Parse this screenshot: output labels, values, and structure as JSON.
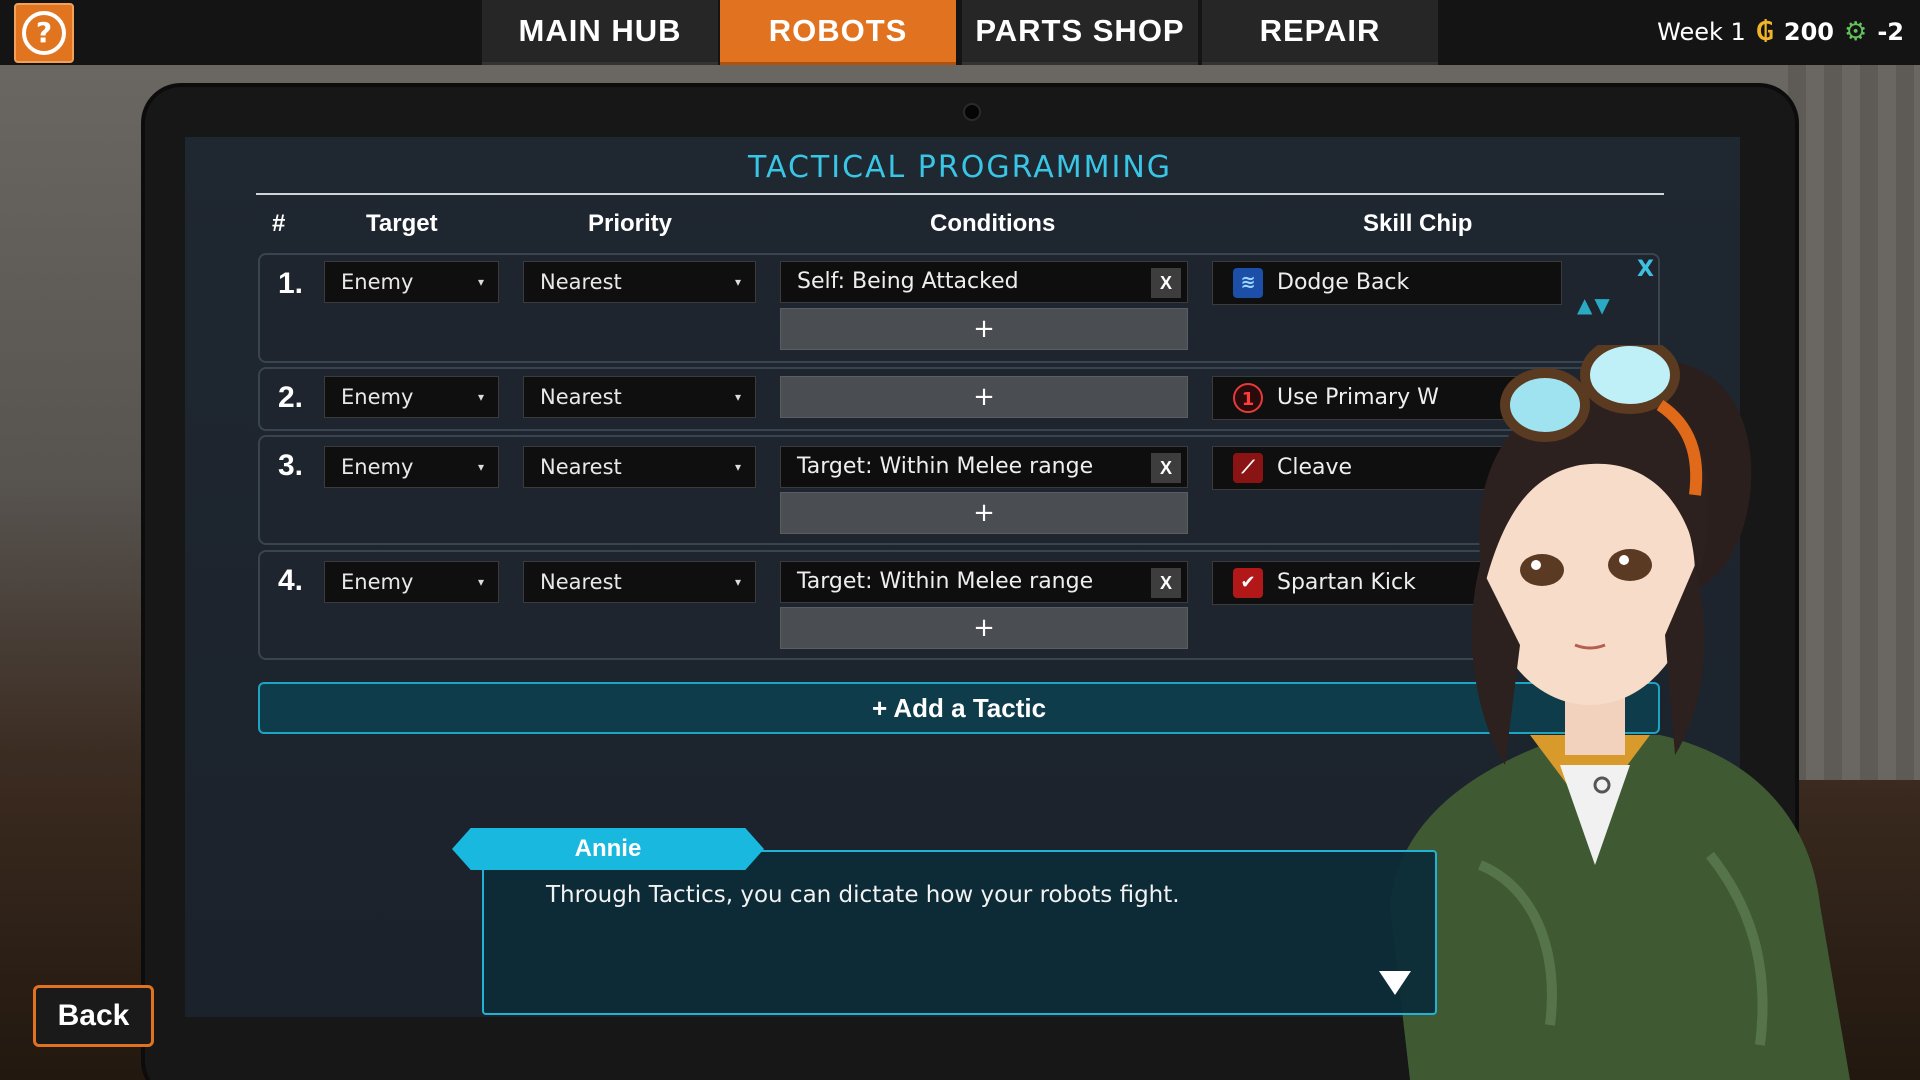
{
  "topbar": {
    "tabs": [
      {
        "label": "MAIN HUB",
        "active": false
      },
      {
        "label": "ROBOTS",
        "active": true
      },
      {
        "label": "PARTS SHOP",
        "active": false
      },
      {
        "label": "REPAIR",
        "active": false
      }
    ],
    "week": "Week 1",
    "money": "200",
    "parts": "-2",
    "help_icon": "question-icon",
    "accent": "#e07220"
  },
  "panel": {
    "title": "TACTICAL PROGRAMMING",
    "headers": {
      "num": "#",
      "target": "Target",
      "priority": "Priority",
      "conditions": "Conditions",
      "skill": "Skill Chip"
    },
    "add_tactic": "+ Add a Tactic",
    "plus": "+",
    "remove": "X",
    "rows": [
      {
        "num": "1.",
        "target": "Enemy",
        "priority": "Nearest",
        "condition": "Self: Being Attacked",
        "skill": "Dodge Back",
        "skill_icon": "dodge-back-icon"
      },
      {
        "num": "2.",
        "target": "Enemy",
        "priority": "Nearest",
        "condition": "",
        "skill": "Use Primary W",
        "skill_icon": "primary-weapon-icon"
      },
      {
        "num": "3.",
        "target": "Enemy",
        "priority": "Nearest",
        "condition": "Target: Within Melee range",
        "skill": "Cleave",
        "skill_icon": "cleave-icon"
      },
      {
        "num": "4.",
        "target": "Enemy",
        "priority": "Nearest",
        "condition": "Target: Within Melee range",
        "skill": "Spartan Kick",
        "skill_icon": "spartan-kick-icon"
      }
    ]
  },
  "dialog": {
    "speaker": "Annie",
    "text": "Through Tactics, you can dictate how your robots fight."
  },
  "back_label": "Back"
}
